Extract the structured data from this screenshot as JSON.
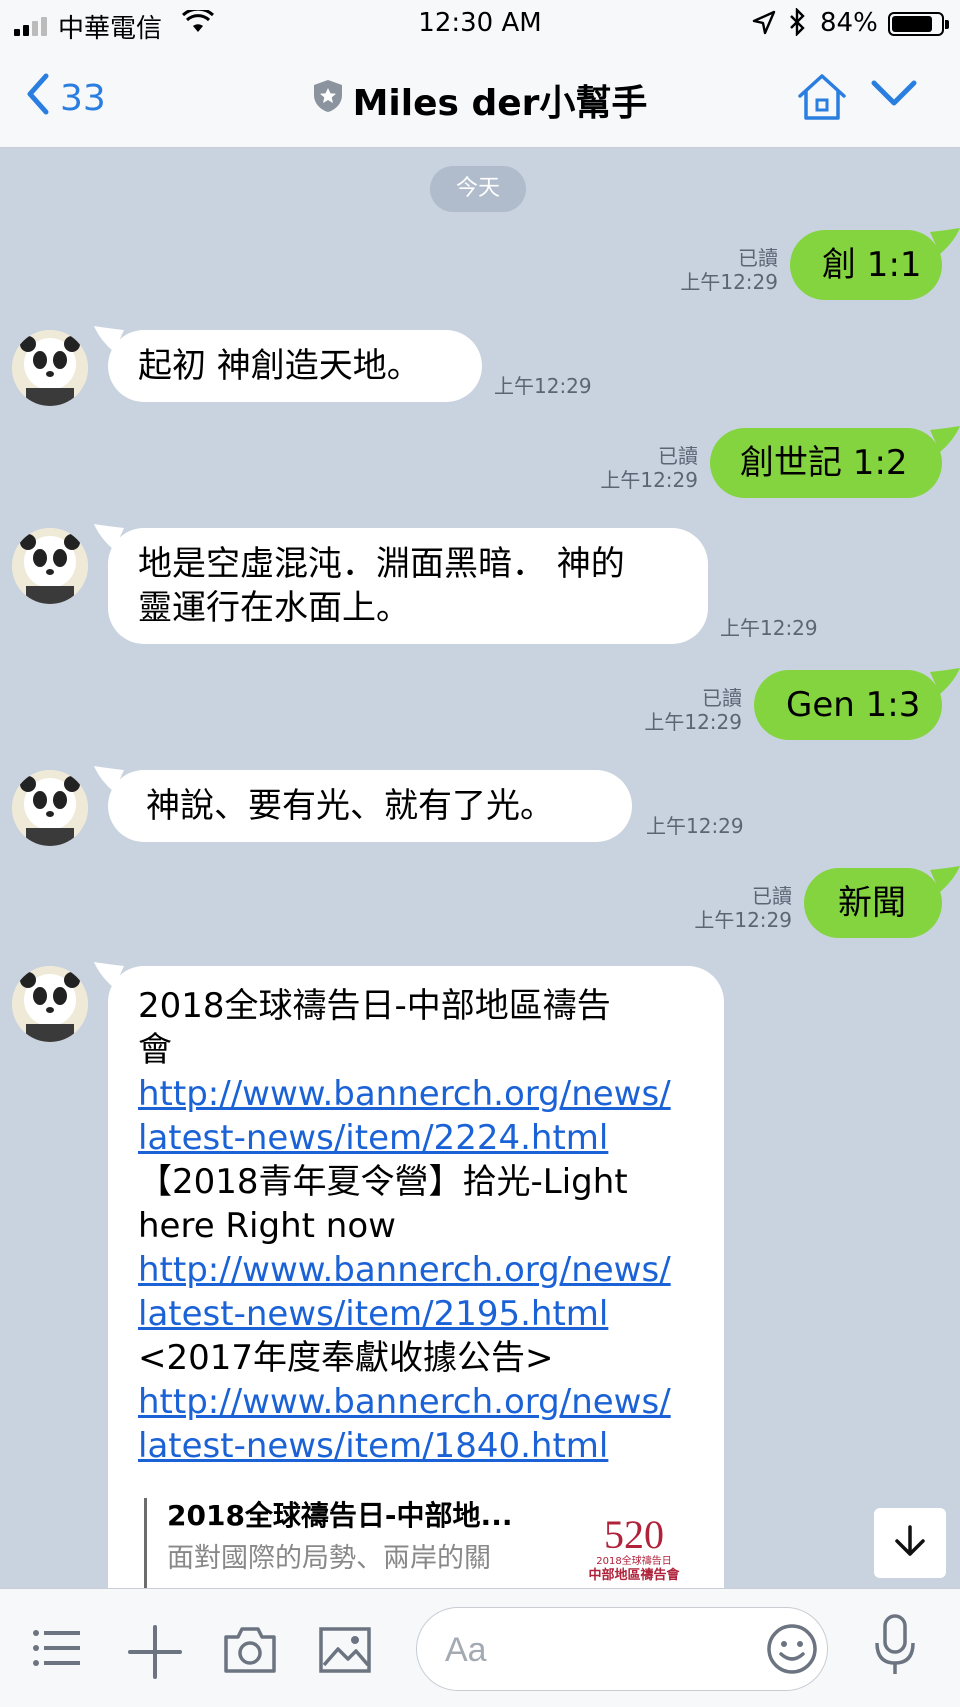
{
  "status_bar": {
    "carrier": "中華電信",
    "time": "12:30 AM",
    "battery_pct": "84%",
    "battery_level": 0.84
  },
  "header": {
    "back_count": "33",
    "title": "Miles der小幫手",
    "icons": [
      "chevron-left-icon",
      "shield-star-icon",
      "home-icon",
      "chevron-down-icon"
    ]
  },
  "date_divider": "今天",
  "messages": [
    {
      "dir": "out",
      "text": "創 1:1",
      "read": "已讀",
      "time": "上午12:29"
    },
    {
      "dir": "in",
      "text": "起初 神創造天地。",
      "time": "上午12:29"
    },
    {
      "dir": "out",
      "text": "創世記 1:2",
      "read": "已讀",
      "time": "上午12:29"
    },
    {
      "dir": "in",
      "lines": [
        "地是空虛混沌．淵面黑暗． 神的",
        "靈運行在水面上。"
      ],
      "time": "上午12:29"
    },
    {
      "dir": "out",
      "text": "Gen 1:3",
      "read": "已讀",
      "time": "上午12:29"
    },
    {
      "dir": "in",
      "text": "神說、要有光、就有了光。",
      "time": "上午12:29"
    },
    {
      "dir": "out",
      "text": "新聞",
      "read": "已讀",
      "time": "上午12:29"
    }
  ],
  "news": {
    "lines": [
      {
        "type": "text",
        "text": "2018全球禱告日-中部地區禱告"
      },
      {
        "type": "text",
        "text": "會"
      },
      {
        "type": "link",
        "text": "http://www.bannerch.org/news/"
      },
      {
        "type": "link",
        "text": "latest-news/item/2224.html"
      },
      {
        "type": "text",
        "text": "【2018青年夏令營】拾光-Light"
      },
      {
        "type": "text",
        "text": "here Right now"
      },
      {
        "type": "link",
        "text": "http://www.bannerch.org/news/"
      },
      {
        "type": "link",
        "text": "latest-news/item/2195.html"
      },
      {
        "type": "text",
        "text": "<2017年度奉獻收據公告>"
      },
      {
        "type": "link",
        "text": "http://www.bannerch.org/news/"
      },
      {
        "type": "link",
        "text": "latest-news/item/1840.html"
      }
    ],
    "preview": {
      "title": "2018全球禱告日-中部地...",
      "desc": "面對國際的局勢、兩岸的關",
      "thumb_big": "520",
      "thumb_small": "2018全球禱告日",
      "thumb_org": "中部地區禱告會"
    }
  },
  "input": {
    "placeholder": "Aa"
  },
  "colors": {
    "chat_bg": "#c8d3df",
    "out_bubble": "#84d43f",
    "in_bubble": "#ffffff",
    "accent": "#2a7ee0",
    "link": "#1a62d6"
  }
}
